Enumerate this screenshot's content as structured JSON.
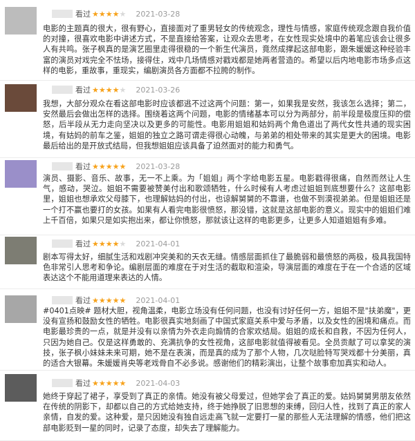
{
  "reviews": [
    {
      "watched": "看过",
      "rating": 4,
      "date": "2021-03-28",
      "avatar_color": "#bcbcbc",
      "text": "电影的主题真的很大，很有野心，直接面对了重男轻女的传统观念，理性与情感，家庭传统观念跟自我价值的对撞，很喜欢电影中讲述方式，不是直接给答案，让观众去思考，在女性现实处境中的着笔应该会让很多人有共鸣。张子枫真的是演艺圈里走得很稳的一个新生代演员，竟然成撑起这部电影，跟朱媛媛这种经验丰富的演员对戏完全不怯场，接得住，戏中几场情感对戳戏都是她两者营造的。希望以后内地电影市场多点这样的电影，重故事，重现实，编剧演员各方面都不拉胯的制作。"
    },
    {
      "watched": "看过",
      "rating": 4,
      "date": "2021-03-26",
      "avatar_color": "#6a4a3a",
      "text": "我想，大部分观众在看这部电影时应该都逃不过这两个问题：第一，如果我是安然，我该怎么选择；第二，安然最后会做出怎样的选择。围绕着这两个问题，电影的情绪基本可以分为两部分，前半段是极度压抑的偿怒，后半段从无力走向坚决以及更多的可能性。电影用姐姐和姑妈两个角色道出了两代女性共通的现实困境，有姑妈的前车之鉴，姐姐的独立之路可谓走得很心动魄，与弟弟的相处带来的其实是更大的困境。电影最后给出的是开放式结局，但我想姐姐应该具备了迫然面对的能力和勇气。"
    },
    {
      "watched": "看过",
      "rating": 5,
      "date": "2021-03-28",
      "avatar_color": "#9a8fc9",
      "text": "演员、摄影、音乐、故事，无一不上乘。为「姐姐」两个字给电影五星。电影戳得很痛，自然而然让人生气，感动，哭泣。姐姐不需要被赞美付出和歌颂牺牲，什么时候有人考虑过姐姐到底想要什么？这部电影里，姐姐也想承欢父母膝下，也理解姑妈的付出，也谅解舅舅的不靠谱，也做不到漠视弟弟。但是姐姐还是一个打不赢也要打的女孩。如果有人看完电影很愤怒，那没错，这就是这部电影的意义。现实中的姐姐们难上千百倍，如果只是如实抱出来，都让你愤怒，那就该让这样的电影更多，让更多人知道姐姐有多难。"
    },
    {
      "watched": "看过",
      "rating": 4,
      "date": "2021-04-01",
      "avatar_color": "#7d7d73",
      "text": "剧本写得太好，细腻生活和戏剧冲突美和的天衣无缝。情感层面抓住了最脆弱和最愤怒的两极，极具我国特色非常引人思考和争论。编剧层面的难度在于对生活的截取和渲染，导演层面的难度在于在一个合适的区域表达这个不能用道理来表达的人情。"
    },
    {
      "watched": "看过",
      "rating": 5,
      "date": "2021-04-01",
      "avatar_color": "#a7a7a7",
      "text": "#0401点映# 题材大胆，视角温柔，电影立场没有任何问题，也没有讨好任何一方，姐姐不是\"扶弟魔\"，更没有宣扬和鼓励女性的牺牲。电影很真实地刻画了中国式家庭关系中爱与矛盾，以及女性的困境和痛点。而电影最珍贵的一点，就是并没有以亲情为外衣走向煽情的合家欢结局。姐姐的成长和自救，不因为任何人，只因为她自己。仅是这样勇敢的、充满抗争的女性视角，这部电影就值得被看见。全员贡献了可以拿奖的演技，张子枫小妹妹未来可期，她不是在表演，而是真的成为了那个人物，几次哒脸特写哭戏都十分美丽，真的适合大银幕。朱媛媛肖央等老戏骨自不必多说。感谢他们的精彩演出，让整个故事愈加真实和动人。"
    },
    {
      "watched": "看过",
      "rating": 5,
      "date": "2021-04-03",
      "avatar_color": "#5c5c5c",
      "text": "她终于穿起了裙子，享受到了真正的亲情。她没有被父母爱过，但她学会了真正的爱。姑妈舅舅男朋友依然在传统的阴影下，却都以自己的方式给她支持，终于她挣脱了旧思想的束缚，回归人性，找到了真正的家人亲情，自发的爱。这种爱，是只因她没有独自远走高飞就一定要打一星的那些人无法理解的情感，他们把这部电影贬到一星的同时，记录了态度，却失去了理解能力。"
    }
  ]
}
